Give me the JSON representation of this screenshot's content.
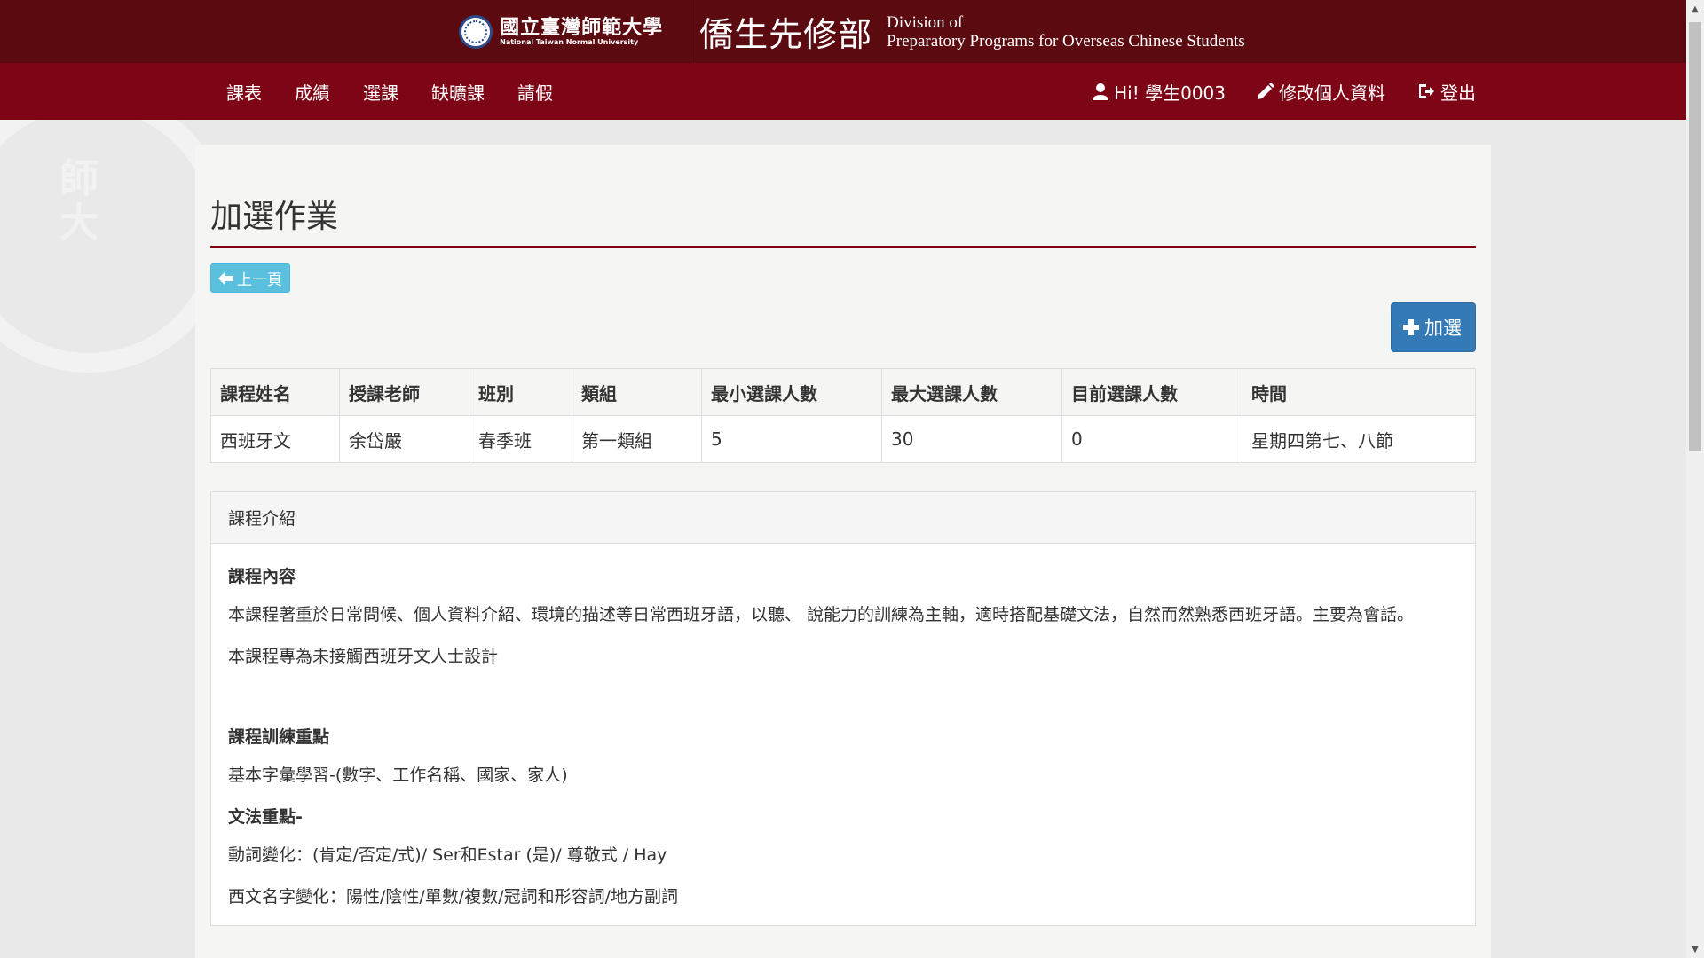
{
  "header": {
    "univ_zh": "國立臺灣師範大學",
    "univ_en": "National Taiwan Normal University",
    "dept_zh": "僑生先修部",
    "dept_en_line1": "Division of",
    "dept_en_line2": "Preparatory Programs for Overseas Chinese Students"
  },
  "nav": {
    "items": [
      {
        "label": "課表"
      },
      {
        "label": "成績"
      },
      {
        "label": "選課"
      },
      {
        "label": "缺曠課"
      },
      {
        "label": "請假"
      }
    ],
    "user_greeting": "Hi!  學生0003",
    "edit_profile": "修改個人資料",
    "logout": "登出"
  },
  "watermark": {
    "text": "師\n大"
  },
  "page": {
    "title": "加選作業",
    "back_label": "上一頁",
    "add_label": "加選"
  },
  "table": {
    "headers": [
      "課程姓名",
      "授課老師",
      "班別",
      "類組",
      "最小選課人數",
      "最大選課人數",
      "目前選課人數",
      "時間"
    ],
    "rows": [
      [
        "西班牙文",
        "余岱嚴",
        "春季班",
        "第一類組",
        "5",
        "30",
        "0",
        "星期四第七、八節"
      ]
    ]
  },
  "intro": {
    "heading": "課程介紹",
    "section1_title": "課程內容",
    "section1_p1": "本課程著重於日常問候、個人資料介紹、環境的描述等日常西班牙語，以聽、 說能力的訓練為主軸，適時搭配基礎文法，自然而然熟悉西班牙語。主要為會話。",
    "section1_p2": "本課程專為未接觸西班牙文人士設計",
    "section2_title": "課程訓練重點",
    "section2_p1": "基本字彙學習-(數字、工作名稱、國家、家人)",
    "section3_title": "文法重點-",
    "section3_p1": "動詞變化：(肯定/否定/式)/ Ser和Estar (是)/ 尊敬式 / Hay",
    "section3_p2": "西文名字變化：陽性/陰性/單數/複數/冠詞和形容詞/地方副詞"
  },
  "colors": {
    "topbar": "#5b0a10",
    "navbar": "#7d0515",
    "primary_button": "#337ab7",
    "info_button": "#5bc0de"
  }
}
